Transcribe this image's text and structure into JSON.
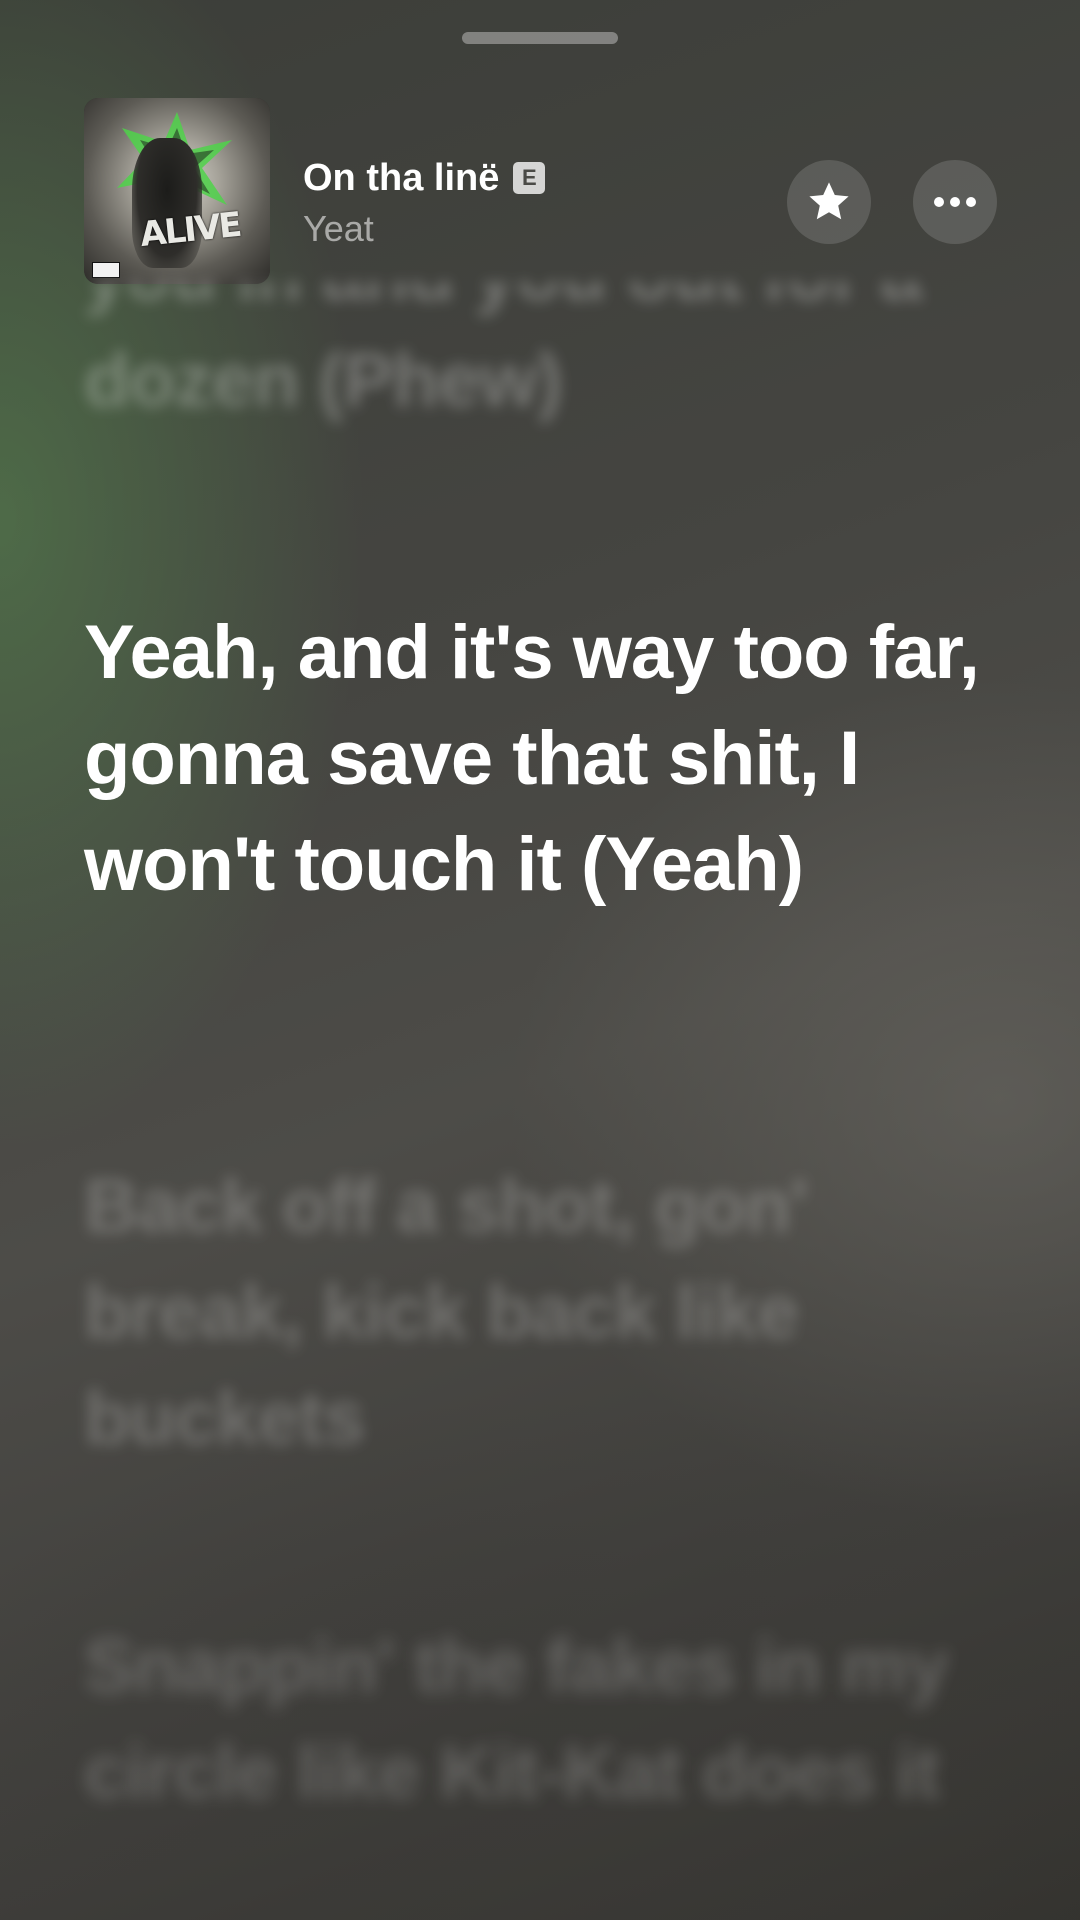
{
  "now_playing": {
    "title": "On tha linë",
    "explicit_badge": "E",
    "artist": "Yeat",
    "artwork_text": "ALIVE",
    "artwork_icon": "album-artwork",
    "favorite_icon": "star-icon",
    "more_icon": "ellipsis-icon"
  },
  "lyrics": {
    "previous": "you in and you out for a dozen (Phew)",
    "current": "Yeah, and it's way too far, gonna save that shit, I won't touch it (Yeah)",
    "next": [
      "Back off a shot, gon' break, kick back like buckets",
      "Snappin' the fakes in my circle like Kit-Kat does it"
    ]
  },
  "colors": {
    "accent_green": "#5a9a52",
    "background": "#45443f",
    "text_primary": "#ffffff",
    "text_secondary": "rgba(255,255,255,0.55)"
  }
}
